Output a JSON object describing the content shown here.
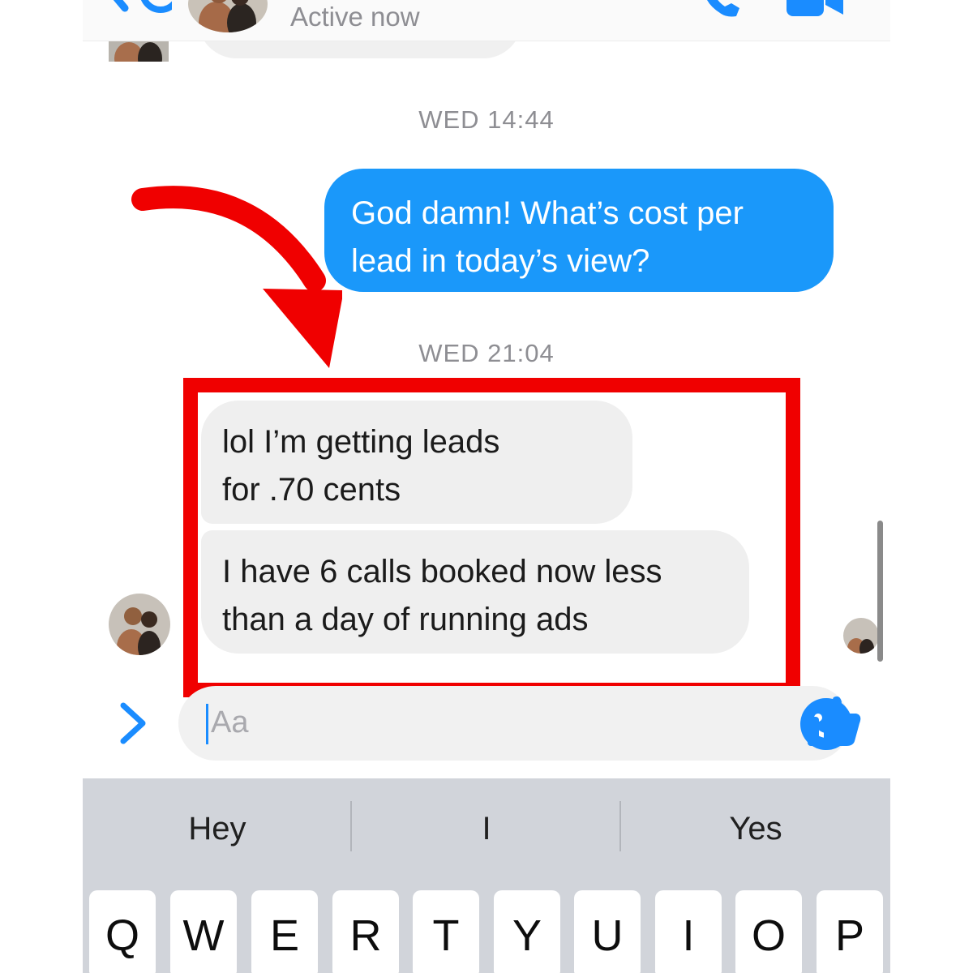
{
  "header": {
    "status": "Active now"
  },
  "thread": {
    "timestamp_1": "WED 14:44",
    "outgoing_message": "God damn! What’s cost per\nlead in today’s view?",
    "timestamp_2": "WED 21:04",
    "incoming_messages": [
      "lol I’m getting leads\nfor .70 cents",
      "I have 6 calls booked now less\nthan a day of running ads"
    ]
  },
  "composer": {
    "placeholder": "Aa"
  },
  "keyboard": {
    "suggestions": [
      "Hey",
      "I",
      "Yes"
    ],
    "keys": [
      "Q",
      "W",
      "E",
      "R",
      "T",
      "Y",
      "U",
      "I",
      "O",
      "P"
    ]
  },
  "colors": {
    "messenger_blue": "#1a98fa",
    "incoming_bubble": "#efefef",
    "highlight_red": "#f00000",
    "keyboard_bg": "#d1d4da"
  },
  "icons": [
    "back-icon",
    "phone-icon",
    "video-icon",
    "expand-icon",
    "emoji-icon",
    "like-icon",
    "annotation-arrow"
  ]
}
